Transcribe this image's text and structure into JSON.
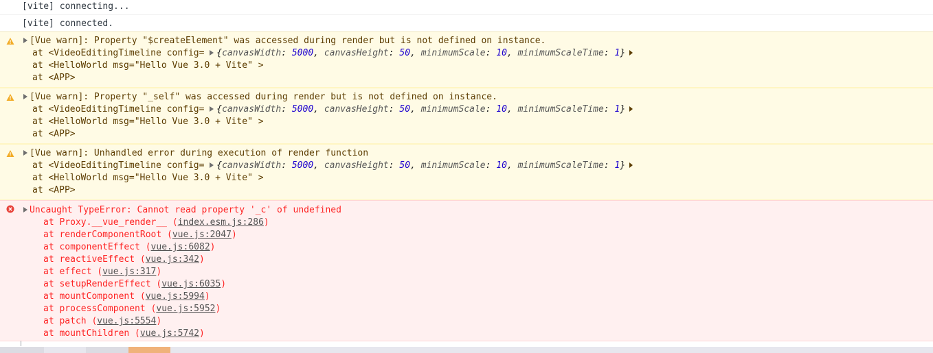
{
  "logs": [
    {
      "text": "[vite] connecting..."
    },
    {
      "text": "[vite] connected."
    }
  ],
  "warnings": [
    {
      "message": "[Vue warn]: Property \"$createElement\" was accessed during render but is not defined on instance.",
      "line1_prefix": "at <VideoEditingTimeline config= ",
      "line2": "at <HelloWorld msg=\"Hello Vue 3.0 + Vite\" >",
      "line3": "at <APP>"
    },
    {
      "message": "[Vue warn]: Property \"_self\" was accessed during render but is not defined on instance.",
      "line1_prefix": "at <VideoEditingTimeline config= ",
      "line2": "at <HelloWorld msg=\"Hello Vue 3.0 + Vite\" >",
      "line3": "at <APP>"
    },
    {
      "message": "[Vue warn]: Unhandled error during execution of render function",
      "line1_prefix": "at <VideoEditingTimeline config= ",
      "line2": "at <HelloWorld msg=\"Hello Vue 3.0 + Vite\" >",
      "line3": "at <APP>"
    }
  ],
  "config_object": {
    "open": "{",
    "k1": "canvasWidth",
    "v1": "5000",
    "k2": "canvasHeight",
    "v2": "50",
    "k3": "minimumScale",
    "v3": "10",
    "k4": "minimumScaleTime",
    "v4": "1",
    "close": "}"
  },
  "error": {
    "message": "Uncaught TypeError: Cannot read property '_c' of undefined",
    "stack": [
      {
        "fn": "at Proxy.__vue_render__ (",
        "file": "index.esm.js:286",
        "end": ")"
      },
      {
        "fn": "at renderComponentRoot (",
        "file": "vue.js:2047",
        "end": ")"
      },
      {
        "fn": "at componentEffect (",
        "file": "vue.js:6082",
        "end": ")"
      },
      {
        "fn": "at reactiveEffect (",
        "file": "vue.js:342",
        "end": ")"
      },
      {
        "fn": "at effect (",
        "file": "vue.js:317",
        "end": ")"
      },
      {
        "fn": "at setupRenderEffect (",
        "file": "vue.js:6035",
        "end": ")"
      },
      {
        "fn": "at mountComponent (",
        "file": "vue.js:5994",
        "end": ")"
      },
      {
        "fn": "at processComponent (",
        "file": "vue.js:5952",
        "end": ")"
      },
      {
        "fn": "at patch (",
        "file": "vue.js:5554",
        "end": ")"
      },
      {
        "fn": "at mountChildren (",
        "file": "vue.js:5742",
        "end": ")"
      }
    ]
  },
  "colors": {
    "warn_bg": "#fffbe5",
    "warn_text": "#5c3c00",
    "error_bg": "#fff0f0",
    "error_text": "#fe2424",
    "number": "#1c00cf"
  },
  "icons": {
    "warning": "warning-triangle-icon",
    "error": "error-circle-icon",
    "expand": "expand-triangle-icon"
  }
}
